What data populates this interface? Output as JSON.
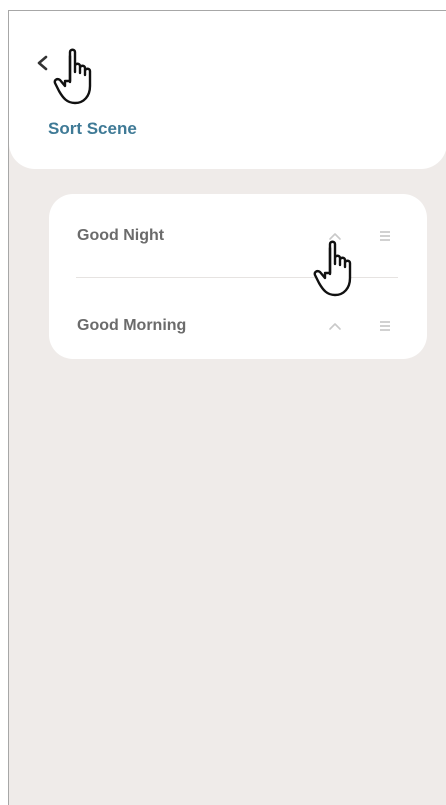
{
  "header": {
    "back_icon": "chevron-left-icon",
    "title": "Sort Scene"
  },
  "scenes": [
    {
      "label": "Good Night",
      "move_up_icon": "chevron-up-icon",
      "drag_icon": "drag-handle-icon"
    },
    {
      "label": "Good Morning",
      "move_up_icon": "chevron-up-icon",
      "drag_icon": "drag-handle-icon"
    }
  ],
  "colors": {
    "title": "#3f7a96",
    "background": "#efebe9",
    "card": "#ffffff",
    "row_text": "#6b6b6b",
    "icon_muted": "#c9c9c9"
  },
  "overlay": {
    "cursor_icon": "hand-pointer-icon"
  }
}
